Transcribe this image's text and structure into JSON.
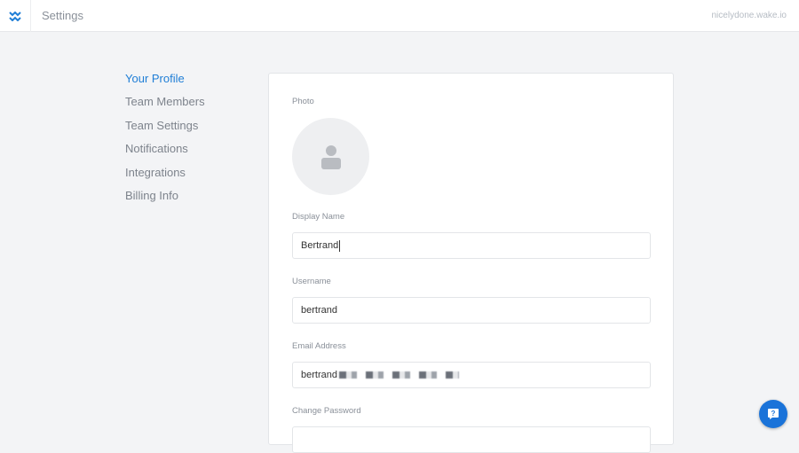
{
  "header": {
    "title": "Settings",
    "workspace": "nicelydone.wake.io"
  },
  "nav": {
    "items": [
      "Your Profile",
      "Team Members",
      "Team Settings",
      "Notifications",
      "Integrations",
      "Billing Info"
    ]
  },
  "profile": {
    "photo_label": "Photo",
    "display_name_label": "Display Name",
    "display_name": "Bertrand",
    "username_label": "Username",
    "username": "bertrand",
    "email_label": "Email Address",
    "email_visible": "bertrand",
    "password_label": "Change Password"
  },
  "colors": {
    "accent": "#1f7ed6",
    "help": "#1a73d9"
  }
}
